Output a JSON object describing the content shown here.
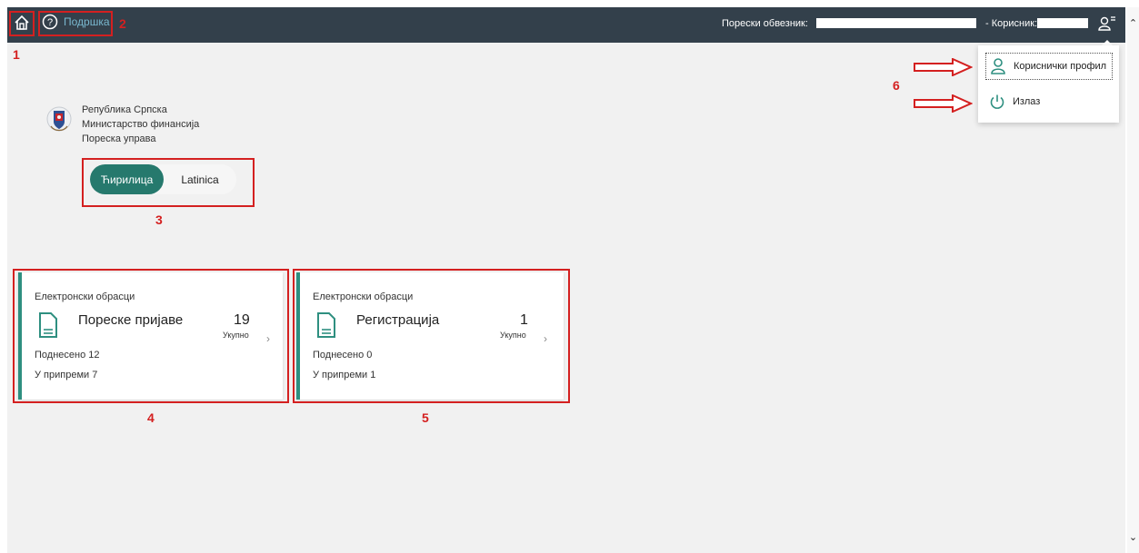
{
  "topbar": {
    "help_label": "Подршка",
    "taxpayer_label": "Порески обвезник:",
    "user_label": "- Корисник:"
  },
  "org": {
    "line1": "Република Српска",
    "line2": "Министарство финансија",
    "line3": "Пореска управа"
  },
  "language": {
    "cyrillic": "Ћирилица",
    "latin": "Latinica",
    "selected": "Ћирилица"
  },
  "cards": [
    {
      "category": "Електронски обрасци",
      "title": "Пореске пријаве",
      "count": "19",
      "count_label": "Укупно",
      "submitted": "Поднесено 12",
      "in_preparation": "У припреми 7"
    },
    {
      "category": "Електронски обрасци",
      "title": "Регистрација",
      "count": "1",
      "count_label": "Укупно",
      "submitted": "Поднесено 0",
      "in_preparation": "У припреми 1"
    }
  ],
  "user_menu": {
    "profile": "Кориснички профил",
    "logout": "Излаз"
  },
  "annotations": {
    "n1": "1",
    "n2": "2",
    "n3": "3",
    "n4": "4",
    "n5": "5",
    "n6": "6"
  },
  "colors": {
    "topbar": "#33404b",
    "accent": "#26796d",
    "annotation": "#d42020",
    "link": "#79b7ce"
  },
  "icons": {
    "home": "home-icon",
    "help": "help-circle-icon",
    "user_menu": "user-menu-icon",
    "document": "document-icon",
    "profile": "user-icon",
    "logout": "power-icon",
    "chevron": "chevron-right-icon"
  }
}
